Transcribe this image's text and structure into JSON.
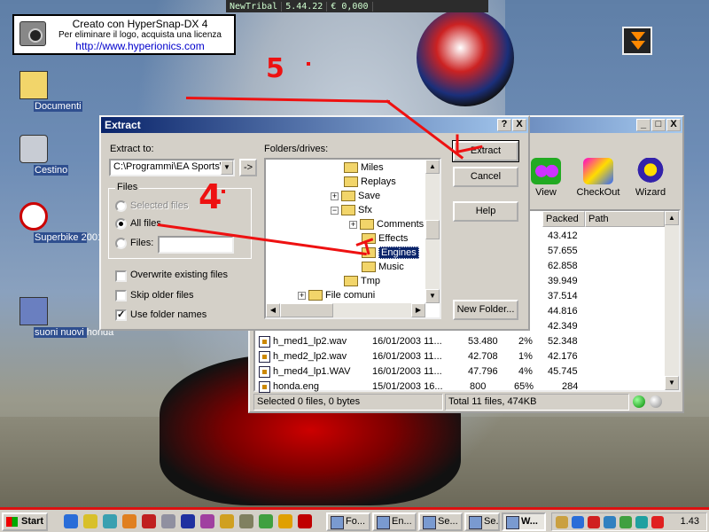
{
  "topbar": {
    "app": "NewTribal",
    "time": "5.44.22",
    "money": "€ 0,000"
  },
  "banner": {
    "line1": "Creato con HyperSnap-DX 4",
    "line2": "Per eliminare il logo, acquista una licenza",
    "line3": "http://www.hyperionics.com"
  },
  "desktop_icons": [
    {
      "label": "Documenti"
    },
    {
      "label": "Cestino"
    },
    {
      "label": "Superbike 2001"
    },
    {
      "label": "suoni nuovi honda"
    }
  ],
  "dialog": {
    "title": "Extract",
    "extract_to_label": "Extract to:",
    "extract_to_value": "C:\\Programmi\\EA Sports\\",
    "arrow_button": "->",
    "files_group": "Files",
    "radio_selected": "Selected files",
    "radio_all": "All files",
    "radio_files": "Files:",
    "files_input": "",
    "check_overwrite": "Overwrite existing files",
    "check_skip": "Skip older files",
    "check_folder_names": "Use folder names",
    "folders_label": "Folders/drives:",
    "tree": [
      "Miles",
      "Replays",
      "Save",
      "Sfx",
      "Comments",
      "Effects",
      "Engines",
      "Music",
      "Tmp",
      "File comuni"
    ],
    "buttons": {
      "extract": "Extract",
      "cancel": "Cancel",
      "help": "Help",
      "new_folder": "New Folder..."
    },
    "help_btn": "?",
    "close_btn": "X"
  },
  "main_window": {
    "controls": {
      "min": "_",
      "max": "□",
      "close": "X"
    },
    "toolbar": [
      "View",
      "CheckOut",
      "Wizard"
    ],
    "columns": [
      "Packed",
      "Path"
    ],
    "partial_packed": [
      "43.412",
      "57.655",
      "62.858",
      "39.949",
      "37.514",
      "44.816",
      "42.349"
    ],
    "rows": [
      {
        "name": "h_med1_lp2.wav",
        "date": "16/01/2003 11...",
        "size": "53.480",
        "ratio": "2%",
        "packed": "52.348"
      },
      {
        "name": "h_med2_lp2.wav",
        "date": "16/01/2003 11...",
        "size": "42.708",
        "ratio": "1%",
        "packed": "42.176"
      },
      {
        "name": "h_med4_lp1.WAV",
        "date": "16/01/2003 11...",
        "size": "47.796",
        "ratio": "4%",
        "packed": "45.745"
      },
      {
        "name": "honda.eng",
        "date": "15/01/2003 16...",
        "size": "800",
        "ratio": "65%",
        "packed": "284"
      }
    ],
    "status_left": "Selected 0 files, 0 bytes",
    "status_right": "Total 11 files, 474KB"
  },
  "annotations": {
    "five": "5",
    "four": "4"
  },
  "taskbar": {
    "start": "Start",
    "tasks": [
      "Fo...",
      "En...",
      "Se...",
      "Se...",
      "W..."
    ],
    "clock": "1.43"
  },
  "colors": {
    "annotation_red": "#ee1111",
    "titlebar": "#0a246a",
    "taskbar_accent": "#dd1111"
  }
}
